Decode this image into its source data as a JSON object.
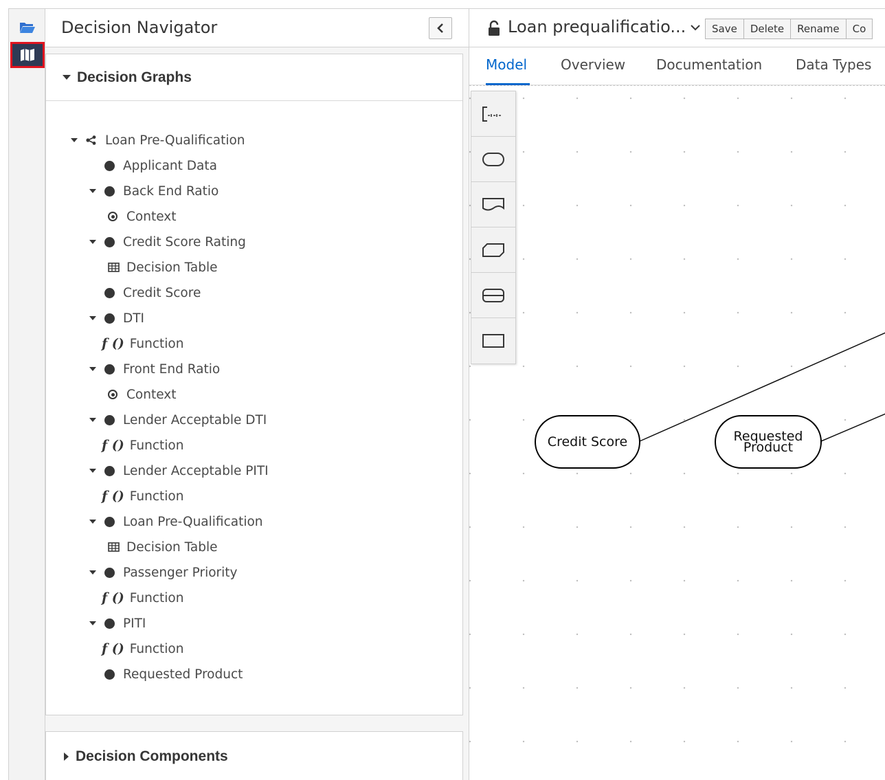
{
  "navigator": {
    "title": "Decision Navigator",
    "graphs_header": "Decision Graphs",
    "components_header": "Decision Components",
    "tree": [
      {
        "label": "Loan Pre-Qualification",
        "kind": "root",
        "level": 0,
        "expanded": true
      },
      {
        "label": "Applicant Data",
        "kind": "node",
        "level": 1,
        "expanded": false
      },
      {
        "label": "Back End Ratio",
        "kind": "node",
        "level": 1,
        "expanded": true
      },
      {
        "label": "Context",
        "kind": "context",
        "level": 2
      },
      {
        "label": "Credit Score Rating",
        "kind": "node",
        "level": 1,
        "expanded": true
      },
      {
        "label": "Decision Table",
        "kind": "table",
        "level": 2
      },
      {
        "label": "Credit Score",
        "kind": "node",
        "level": 1,
        "expanded": false
      },
      {
        "label": "DTI",
        "kind": "node",
        "level": 1,
        "expanded": true
      },
      {
        "label": "Function",
        "kind": "function",
        "level": 2
      },
      {
        "label": "Front End Ratio",
        "kind": "node",
        "level": 1,
        "expanded": true
      },
      {
        "label": "Context",
        "kind": "context",
        "level": 2
      },
      {
        "label": "Lender Acceptable DTI",
        "kind": "node",
        "level": 1,
        "expanded": true
      },
      {
        "label": "Function",
        "kind": "function",
        "level": 2
      },
      {
        "label": "Lender Acceptable PITI",
        "kind": "node",
        "level": 1,
        "expanded": true
      },
      {
        "label": "Function",
        "kind": "function",
        "level": 2
      },
      {
        "label": "Loan Pre-Qualification",
        "kind": "node",
        "level": 1,
        "expanded": true
      },
      {
        "label": "Decision Table",
        "kind": "table",
        "level": 2
      },
      {
        "label": "Passenger Priority",
        "kind": "node",
        "level": 1,
        "expanded": true
      },
      {
        "label": "Function",
        "kind": "function",
        "level": 2
      },
      {
        "label": "PITI",
        "kind": "node",
        "level": 1,
        "expanded": true
      },
      {
        "label": "Function",
        "kind": "function",
        "level": 2
      },
      {
        "label": "Requested Product",
        "kind": "node",
        "level": 1,
        "expanded": false
      }
    ]
  },
  "editor": {
    "title": "Loan prequalificatio...",
    "buttons": {
      "save": "Save",
      "delete": "Delete",
      "rename": "Rename",
      "copy": "Co"
    },
    "tabs": {
      "model": "Model",
      "overview": "Overview",
      "documentation": "Documentation",
      "data_types": "Data Types"
    },
    "fn_glyph": "f ()",
    "nodes": {
      "credit_score": "Credit Score",
      "requested_product_1": "Requested",
      "requested_product_2": "Product"
    }
  },
  "colors": {
    "accent": "#0066cc",
    "rail_active": "#2e3a55",
    "highlight": "#e0141f"
  },
  "icons": [
    "folder-icon",
    "map-icon",
    "chevron-left-icon",
    "lock-icon",
    "chevron-down-icon"
  ]
}
